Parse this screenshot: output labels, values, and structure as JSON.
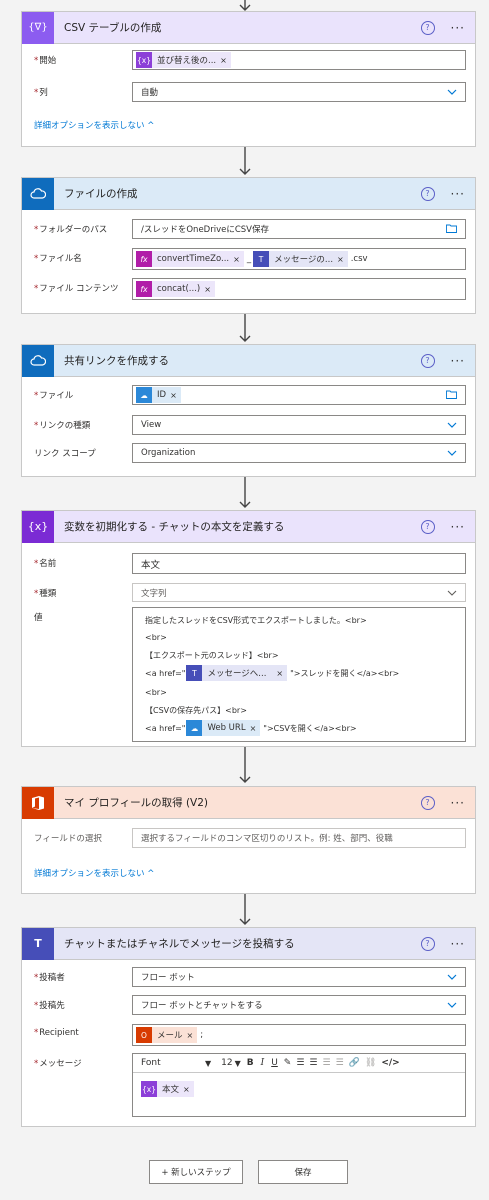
{
  "colors": {
    "purple": "#a78bfa",
    "purple_dark": "#7b2bd4",
    "purple_token": "#8c3fd8",
    "onedrive": "#0f6cbd",
    "office": "#d83b01",
    "teams": "#464eb8",
    "link": "#0078d4"
  },
  "card1": {
    "title": "CSV テーブルの作成",
    "icon": "{∇}",
    "from_label": "開始",
    "from_token": "並び替え後の...",
    "columns_label": "列",
    "columns_value": "自動",
    "advanced_link": "詳細オプションを表示しない ^"
  },
  "card2": {
    "title": "ファイルの作成",
    "folder_label": "フォルダーのパス",
    "folder_value": "/スレッドをOneDriveにCSV保存",
    "name_label": "ファイル名",
    "name_token1": "convertTimeZo...",
    "name_sep": "_",
    "name_token2": "メッセージの...",
    "name_ext": ".csv",
    "content_label": "ファイル コンテンツ",
    "content_token": "concat(...)"
  },
  "card3": {
    "title": "共有リンクを作成する",
    "file_label": "ファイル",
    "file_token": "ID",
    "type_label": "リンクの種類",
    "type_value": "View",
    "scope_label": "リンク スコープ",
    "scope_value": "Organization"
  },
  "card4": {
    "title": "変数を初期化する - チャットの本文を定義する",
    "icon": "{x}",
    "name_label": "名前",
    "name_value": "本文",
    "type_label": "種類",
    "type_value": "文字列",
    "value_label": "値",
    "value_lines": {
      "l1": "指定したスレッドをCSV形式でエクスポートしました。<br>",
      "l2": "<br>",
      "l3": "【エクスポート元のスレッド】<br>",
      "l4a": "<a href=\"",
      "l4token": "メッセージへ...",
      "l4b": "\">スレッドを開く</a><br>",
      "l5": "<br>",
      "l6": "【CSVの保存先パス】<br>",
      "l7a": "<a href=\"",
      "l7token": "Web URL",
      "l7b": "\">CSVを開く</a><br>"
    }
  },
  "card5": {
    "title": "マイ プロフィールの取得 (V2)",
    "fields_label": "フィールドの選択",
    "fields_placeholder": "選択するフィールドのコンマ区切りのリスト。例: 姓、部門、役職",
    "advanced_link": "詳細オプションを表示しない ^"
  },
  "card6": {
    "title": "チャットまたはチャネルでメッセージを投稿する",
    "poster_label": "投稿者",
    "poster_value": "フロー ボット",
    "post_in_label": "投稿先",
    "post_in_value": "フロー ボットとチャットをする",
    "recipient_label": "Recipient",
    "recipient_token": "メール",
    "recipient_suffix": ";",
    "message_label": "メッセージ",
    "font_label": "Font",
    "font_size": "12",
    "message_token": "本文"
  },
  "footer": {
    "new_step": "+ 新しいステップ",
    "save": "保存"
  },
  "common": {
    "help": "?",
    "more": "···",
    "close": "×",
    "req": "*"
  }
}
